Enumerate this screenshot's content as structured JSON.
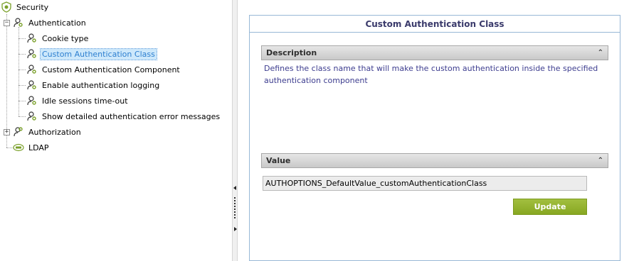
{
  "tree": {
    "root": {
      "label": "Security",
      "icon": "shield-icon"
    },
    "authentication": {
      "label": "Authentication",
      "icon": "user-key-icon",
      "children": [
        {
          "label": "Cookie type",
          "icon": "user-key-icon"
        },
        {
          "label": "Custom Authentication Class",
          "icon": "user-key-icon",
          "selected": true
        },
        {
          "label": "Custom Authentication Component",
          "icon": "user-key-icon"
        },
        {
          "label": "Enable authentication logging",
          "icon": "user-key-icon"
        },
        {
          "label": "Idle sessions time-out",
          "icon": "user-key-icon"
        },
        {
          "label": "Show detailed authentication error messages",
          "icon": "user-key-icon"
        }
      ]
    },
    "authorization": {
      "label": "Authorization",
      "icon": "user-key-icon"
    },
    "ldap": {
      "label": "LDAP",
      "icon": "ldap-icon"
    }
  },
  "panel": {
    "title": "Custom Authentication Class",
    "description": {
      "header": "Description",
      "text": "Defines the class name that will make the custom authentication inside the specified authentication component"
    },
    "value": {
      "header": "Value",
      "input_value": "AUTHOPTIONS_DefaultValue_customAuthenticationClass",
      "update_label": "Update"
    },
    "collapse_glyph": "˄˄"
  },
  "colors": {
    "accent_green": "#8fae2a",
    "selection_text": "#2d7fd0",
    "description_text": "#3d3d8f",
    "panel_border": "#98b8d6"
  }
}
